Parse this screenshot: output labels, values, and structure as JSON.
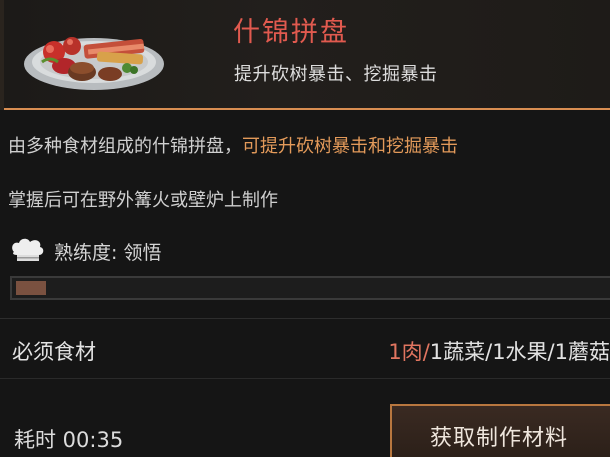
{
  "recipe": {
    "title": "什锦拼盘",
    "effect": "提升砍树暴击、挖掘暴击",
    "description_prefix": "由多种食材组成的什锦拼盘，",
    "description_highlight": "可提升砍树暴击和挖掘暴击",
    "description_line2": "掌握后可在野外篝火或壁炉上制作",
    "dish_icon": "mixed-platter-icon"
  },
  "proficiency": {
    "icon": "chef-hat-icon",
    "label": "熟练度: 领悟",
    "progress": 0.05
  },
  "ingredients": {
    "label": "必须食材",
    "meat": "1肉",
    "sep": "/",
    "rest": "1蔬菜/1水果/1蘑菇"
  },
  "craft": {
    "time_label": "耗时 00:35",
    "button_label": "获取制作材料"
  },
  "colors": {
    "accent": "#d98e52",
    "title": "#e15a4f",
    "highlight": "#e39a5a",
    "meat": "#e17560"
  }
}
